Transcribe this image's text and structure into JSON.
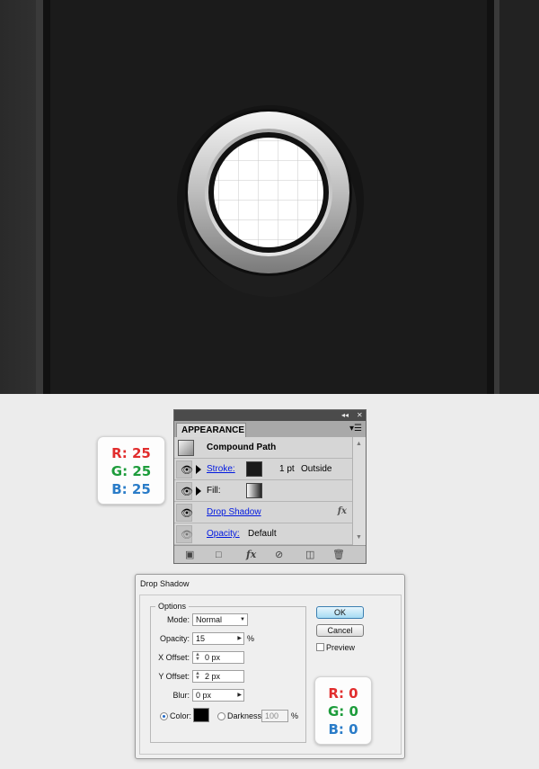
{
  "swatch_top": {
    "r": "R: 25",
    "g": "G: 25",
    "b": "B: 25"
  },
  "swatch_bottom": {
    "r": "R: 0",
    "g": "G: 0",
    "b": "B: 0"
  },
  "appearance": {
    "tab": "APPEARANCE",
    "collapse": "◂◂",
    "close": "✕",
    "rows": {
      "title": "Compound Path",
      "stroke_label": "Stroke:",
      "stroke_weight": "1 pt",
      "stroke_align": "Outside",
      "fill_label": "Fill:",
      "effect": "Drop Shadow",
      "opacity_label": "Opacity:",
      "opacity_value": "Default"
    },
    "fx": "fx"
  },
  "dialog": {
    "title": "Drop Shadow",
    "group": "Options",
    "mode_label": "Mode:",
    "mode_value": "Normal",
    "opacity_label": "Opacity:",
    "opacity_value": "15",
    "opacity_unit": "%",
    "xoffset_label": "X Offset:",
    "xoffset_value": "0 px",
    "yoffset_label": "Y Offset:",
    "yoffset_value": "2 px",
    "blur_label": "Blur:",
    "blur_value": "0 px",
    "color_label": "Color:",
    "darkness_label": "Darkness:",
    "darkness_value": "100",
    "darkness_unit": "%",
    "ok": "OK",
    "cancel": "Cancel",
    "preview": "Preview",
    "shadow_color": "#000000"
  },
  "colors": {
    "red": "#e12d2d",
    "green": "#1d9c3b",
    "blue": "#2a7cc8",
    "link": "#0018e0"
  }
}
